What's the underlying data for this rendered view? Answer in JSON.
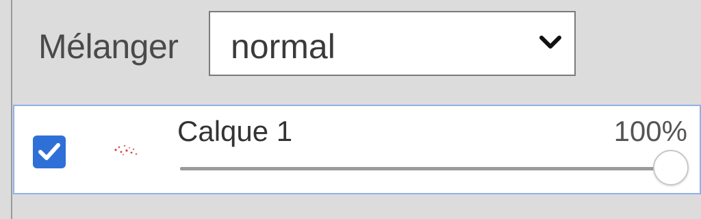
{
  "blend": {
    "label": "Mélanger",
    "selected_value": "normal"
  },
  "layer": {
    "visible": true,
    "name": "Calque 1",
    "opacity_text": "100%",
    "opacity_fraction": 1.0
  },
  "colors": {
    "panel_bg": "#dcdcdc",
    "accent": "#2f6fd8",
    "row_border": "#8fb0ea"
  },
  "icons": {
    "dropdown": "chevron-down-icon",
    "checkbox": "checkmark-icon",
    "thumbnail": "layer-thumbnail"
  }
}
